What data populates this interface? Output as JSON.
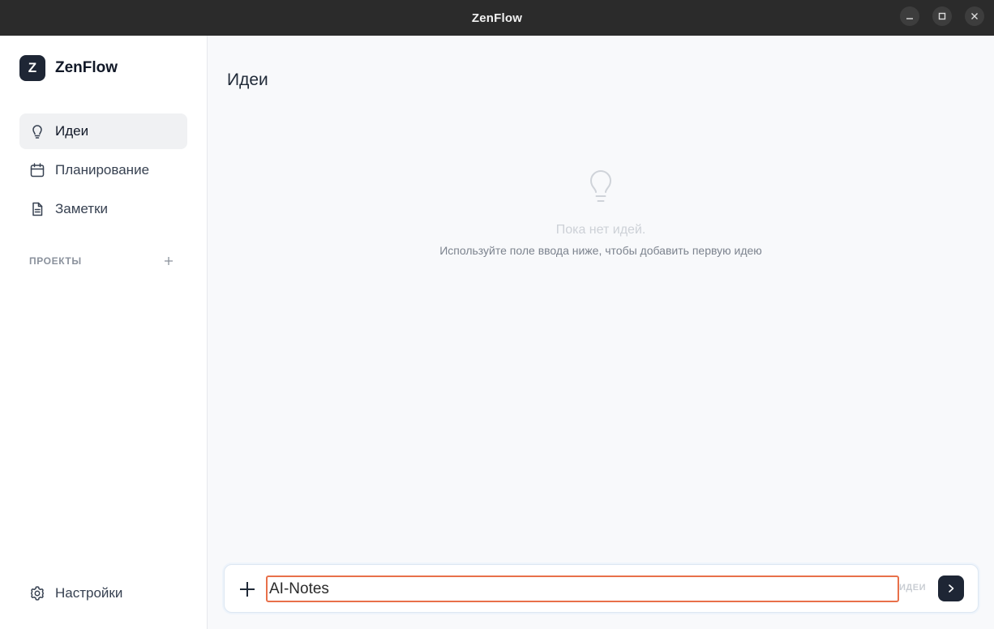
{
  "window": {
    "title": "ZenFlow"
  },
  "sidebar": {
    "brand_letter": "Z",
    "brand_name": "ZenFlow",
    "items": [
      {
        "label": "Идеи",
        "icon": "lightbulb-icon",
        "active": true
      },
      {
        "label": "Планирование",
        "icon": "calendar-icon",
        "active": false
      },
      {
        "label": "Заметки",
        "icon": "document-icon",
        "active": false
      }
    ],
    "projects_label": "ПРОЕКТЫ",
    "settings_label": "Настройки"
  },
  "main": {
    "title": "Идеи",
    "empty_title": "Пока нет идей.",
    "empty_subtitle": "Используйте поле ввода ниже, чтобы добавить первую идею"
  },
  "composer": {
    "value": "AI-Notes",
    "tag": "ИДЕИ"
  },
  "colors": {
    "accent_dark": "#1e2635",
    "input_border": "#e8704a",
    "titlebar": "#2b2b2b"
  }
}
